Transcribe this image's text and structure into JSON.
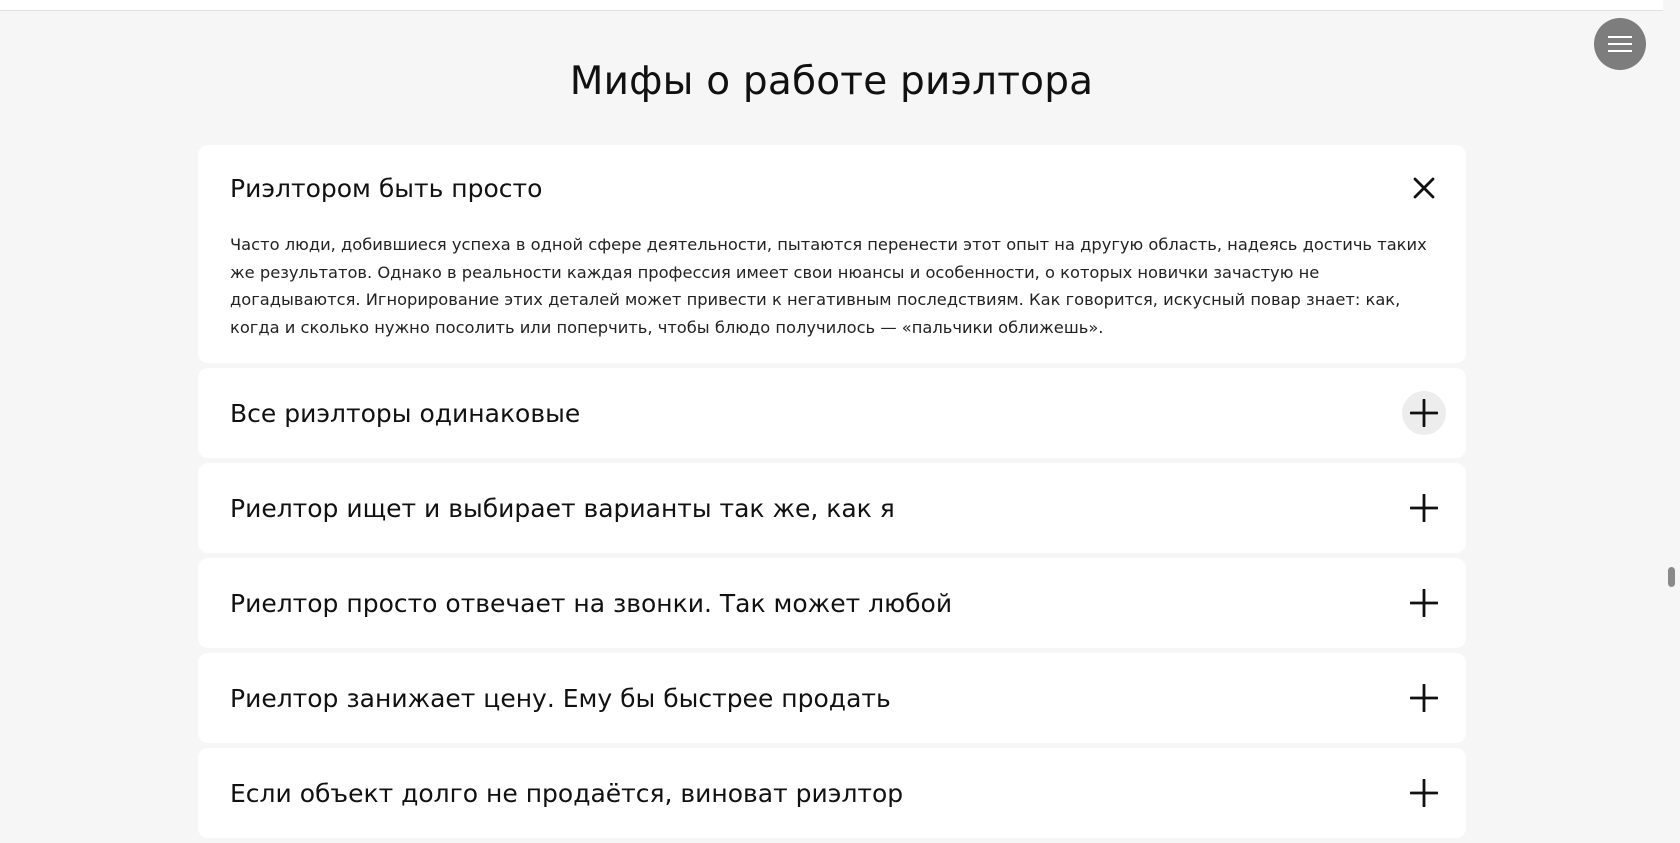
{
  "section": {
    "title": "Мифы о работе риэлтора"
  },
  "accordion": {
    "items": [
      {
        "title": "Риэлтором быть просто",
        "open": true,
        "body": "Часто люди, добившиеся успеха в одной сфере деятельности, пытаются перенести этот опыт на другую область, надеясь достичь таких же результатов. Однако в реальности каждая профессия имеет свои нюансы и особенности, о которых новички зачастую не догадываются. Игнорирование этих деталей может привести к негативным последствиям. Как говорится, искусный повар знает: как, когда и сколько нужно посолить или поперчить, чтобы блюдо получилось — «пальчики оближешь»."
      },
      {
        "title": "Все риэлторы одинаковые",
        "open": false
      },
      {
        "title": "Риелтор ищет и выбирает варианты так же, как я",
        "open": false
      },
      {
        "title": "Риелтор просто отвечает на звонки. Так может любой",
        "open": false
      },
      {
        "title": "Риелтор занижает цену. Ему бы быстрее продать",
        "open": false
      },
      {
        "title": "Если объект долго не продаётся, виноват риэлтор",
        "open": false
      }
    ]
  },
  "icons": {
    "menu": "hamburger-icon",
    "open_toggle": "close-icon",
    "closed_toggle": "plus-icon"
  },
  "colors": {
    "background": "#f6f6f6",
    "card": "#ffffff",
    "menu_button": "#7d7d7d",
    "text": "#111111"
  }
}
